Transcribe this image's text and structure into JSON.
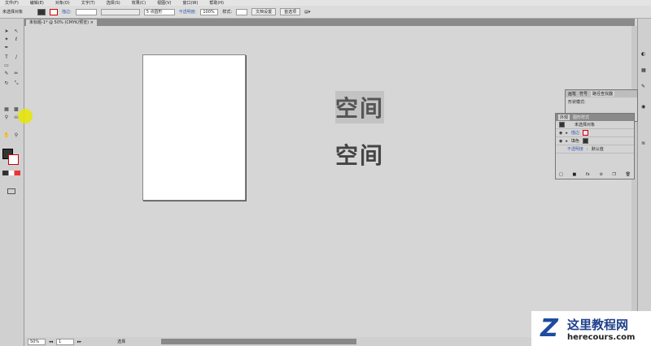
{
  "menu": [
    "文件(F)",
    "编辑(E)",
    "对象(O)",
    "文字(T)",
    "选择(S)",
    "效果(C)",
    "视图(V)",
    "窗口(W)",
    "帮助(H)"
  ],
  "control": {
    "selection": "未选择对象",
    "stroke_label": "描边:",
    "brush": "5 点圆形",
    "opacity_label": "不透明度:",
    "opacity": "100%",
    "style_label": "样式:",
    "doc_setup": "文档设置",
    "prefs": "首选项"
  },
  "doc_tab": {
    "title": "未标题-1* @ 50% (CMYK/预览)",
    "close": "×"
  },
  "canvas": {
    "text1": "空间",
    "text2": "空间"
  },
  "back_panel": {
    "tabs": [
      "画笔",
      "符号",
      "路径查找器"
    ],
    "shape_modes": "形状模式:"
  },
  "appearance": {
    "tabs": [
      "外观",
      "图形样式"
    ],
    "object": "未选择对象",
    "stroke": "描边",
    "fill": "填色",
    "opacity_label": "不透明度",
    "opacity_value": "默认值"
  },
  "status": {
    "zoom": "50%",
    "page": "1",
    "tool": "选择"
  },
  "watermark": {
    "name": "这里教程网",
    "url": "herecours.com"
  }
}
